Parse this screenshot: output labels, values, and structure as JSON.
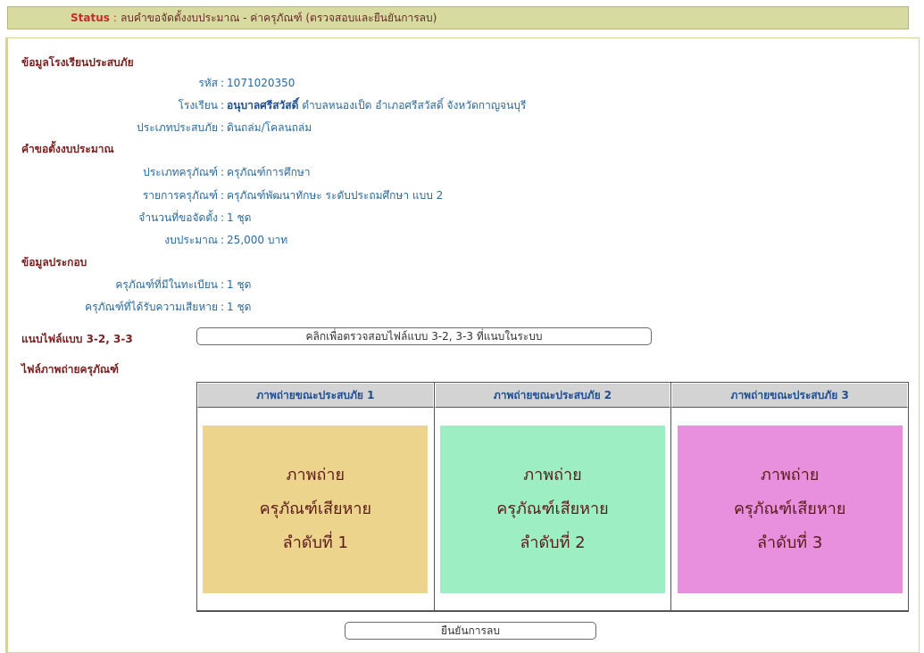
{
  "status": {
    "label": "Status",
    "colon": ":",
    "text": "ลบคำขอจัดตั้งงบประมาณ - ค่าครุภัณฑ์ (ตรวจสอบและยืนยันการลบ)"
  },
  "school_section": {
    "title": "ข้อมูลโรงเรียนประสบภัย",
    "code_label": "รหัส",
    "code_value": "1071020350",
    "school_label": "โรงเรียน",
    "school_name": "อนุบาลศรีสวัสดิ์",
    "school_location": "ตำบลหนองเป็ด อำเภอศรีสวัสดิ์ จังหวัดกาญจนบุรี",
    "disaster_label": "ประเภทประสบภัย",
    "disaster_value": "ดินถล่ม/โคลนถล่ม"
  },
  "request_section": {
    "title": "คำขอตั้งงบประมาณ",
    "type_label": "ประเภทครุภัณฑ์",
    "type_value": "ครุภัณฑ์การศึกษา",
    "item_label": "รายการครุภัณฑ์",
    "item_value": "ครุภัณฑ์พัฒนาทักษะ ระดับประถมศึกษา แบบ 2",
    "qty_label": "จำนวนที่ขอจัดตั้ง",
    "qty_value": "1 ชุด",
    "budget_label": "งบประมาณ",
    "budget_value": "25,000 บาท"
  },
  "extra_section": {
    "title": "ข้อมูลประกอบ",
    "registered_label": "ครุภัณฑ์ที่มีในทะเบียน",
    "registered_value": "1 ชุด",
    "damaged_label": "ครุภัณฑ์ที่ได้รับความเสียหาย",
    "damaged_value": "1 ชุด"
  },
  "attach": {
    "label": "แนบไฟล์แบบ 3-2, 3-3",
    "button": "คลิกเพื่อตรวจสอบไฟล์แบบ 3-2, 3-3 ที่แนบในระบบ"
  },
  "photos": {
    "title": "ไฟล์ภาพถ่ายครุภัณฑ์",
    "items": [
      {
        "header": "ภาพถ่ายขณะประสบภัย 1",
        "line1": "ภาพถ่าย",
        "line2": "ครุภัณฑ์เสียหาย",
        "line3": "ลำดับที่ 1",
        "color": "#ecd48c"
      },
      {
        "header": "ภาพถ่ายขณะประสบภัย 2",
        "line1": "ภาพถ่าย",
        "line2": "ครุภัณฑ์เสียหาย",
        "line3": "ลำดับที่ 2",
        "color": "#9eeec4"
      },
      {
        "header": "ภาพถ่ายขณะประสบภัย 3",
        "line1": "ภาพถ่าย",
        "line2": "ครุภัณฑ์เสียหาย",
        "line3": "ลำดับที่ 3",
        "color": "#e890de"
      }
    ]
  },
  "confirm_button": "ยืนยันการลบ"
}
